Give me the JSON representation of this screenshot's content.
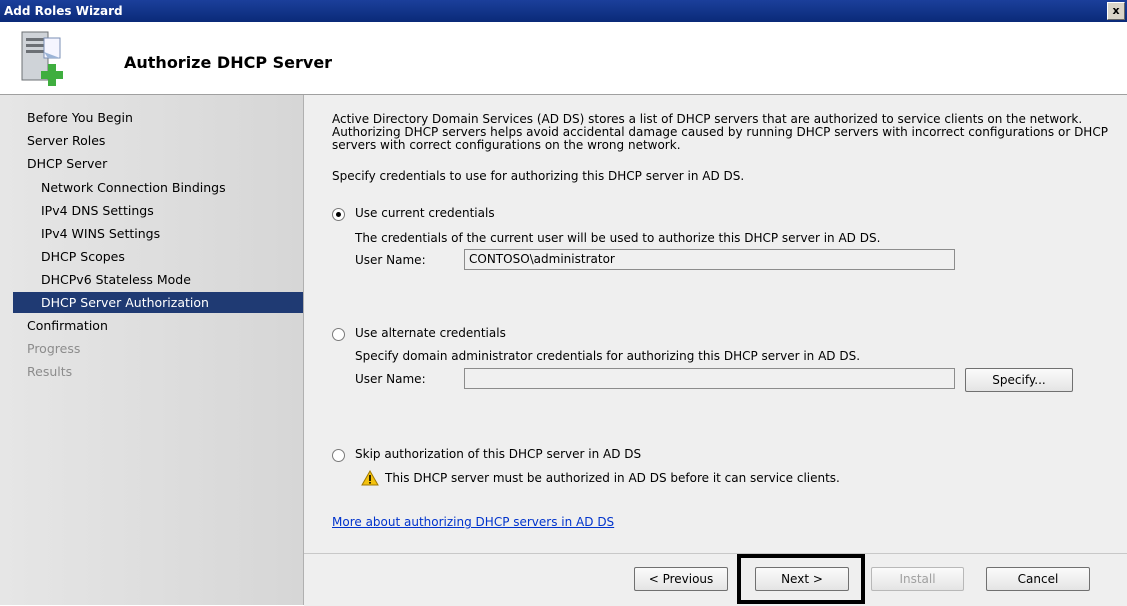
{
  "window": {
    "title": "Add Roles Wizard",
    "close_glyph": "x"
  },
  "header": {
    "title": "Authorize DHCP Server",
    "icon": "server-add-icon"
  },
  "sidebar": {
    "items": [
      {
        "label": "Before You Begin",
        "state": "normal"
      },
      {
        "label": "Server Roles",
        "state": "normal"
      },
      {
        "label": "DHCP Server",
        "state": "normal"
      },
      {
        "label": "Network Connection Bindings",
        "state": "normal"
      },
      {
        "label": "IPv4 DNS Settings",
        "state": "normal"
      },
      {
        "label": "IPv4 WINS Settings",
        "state": "normal"
      },
      {
        "label": "DHCP Scopes",
        "state": "normal"
      },
      {
        "label": "DHCPv6 Stateless Mode",
        "state": "normal"
      },
      {
        "label": "DHCP Server Authorization",
        "state": "selected"
      },
      {
        "label": "Confirmation",
        "state": "normal"
      },
      {
        "label": "Progress",
        "state": "disabled"
      },
      {
        "label": "Results",
        "state": "disabled"
      }
    ]
  },
  "main": {
    "intro": "Active Directory Domain Services (AD DS) stores a list of DHCP servers that are authorized to service clients on the network. Authorizing DHCP servers helps avoid accidental damage caused by running DHCP servers with incorrect configurations or DHCP servers with correct configurations on the wrong network.",
    "instruction": "Specify credentials to use for authorizing this DHCP server in AD DS.",
    "option_current": {
      "label": "Use current credentials",
      "selected": true,
      "description": "The credentials of the current user will be used to authorize this DHCP server in AD DS.",
      "username_label": "User Name:",
      "username_value": "CONTOSO\\administrator"
    },
    "option_alternate": {
      "label": "Use alternate credentials",
      "selected": false,
      "description": "Specify domain administrator credentials for authorizing this DHCP server in AD DS.",
      "username_label": "User Name:",
      "username_value": "",
      "specify_button": "Specify..."
    },
    "option_skip": {
      "label": "Skip authorization of this DHCP server in AD DS",
      "selected": false,
      "warning": "This DHCP server must be authorized in AD DS before it can service clients."
    },
    "more_link": "More about authorizing DHCP servers in AD DS"
  },
  "footer": {
    "previous": "< Previous",
    "next": "Next >",
    "install": "Install",
    "cancel": "Cancel"
  }
}
